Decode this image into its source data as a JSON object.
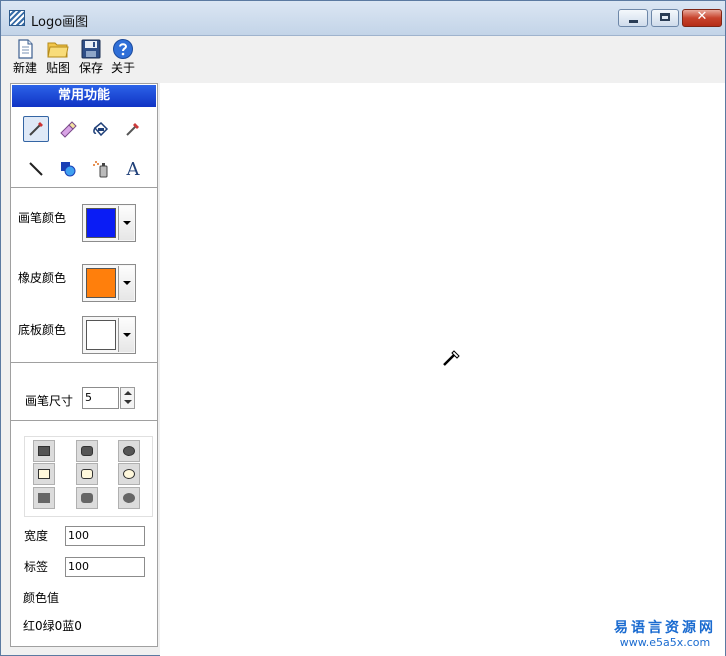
{
  "window": {
    "title": "Logo画图",
    "close_glyph": "✕"
  },
  "toolbar": {
    "new_label": "新建",
    "paste_label": "贴图",
    "save_label": "保存",
    "about_label": "关于"
  },
  "panel": {
    "header": "常用功能",
    "tools": [
      {
        "name": "brush-icon",
        "selected": true
      },
      {
        "name": "eraser-icon",
        "selected": false
      },
      {
        "name": "fill-icon",
        "selected": false
      },
      {
        "name": "eyedropper-icon",
        "selected": false
      },
      {
        "name": "line-icon",
        "selected": false
      },
      {
        "name": "shapes-icon",
        "selected": false
      },
      {
        "name": "spray-icon",
        "selected": false
      },
      {
        "name": "text-icon",
        "selected": false
      }
    ],
    "text_tool_glyph": "A",
    "pen_color_label": "画笔颜色",
    "pen_color": "#0a1cf5",
    "eraser_color_label": "橡皮颜色",
    "eraser_color": "#ff7f0c",
    "background_color_label": "底板颜色",
    "background_color": "#ffffff",
    "brush_size_label": "画笔尺寸",
    "brush_size": "5",
    "width_label": "宽度",
    "width_value": "100",
    "tag_label": "标签",
    "tag_value": "100",
    "color_value_label": "颜色值",
    "color_value": "红0绿0蓝0"
  },
  "watermark": {
    "text_cn": "易语言资源网",
    "url": "www.e5a5x.com"
  }
}
